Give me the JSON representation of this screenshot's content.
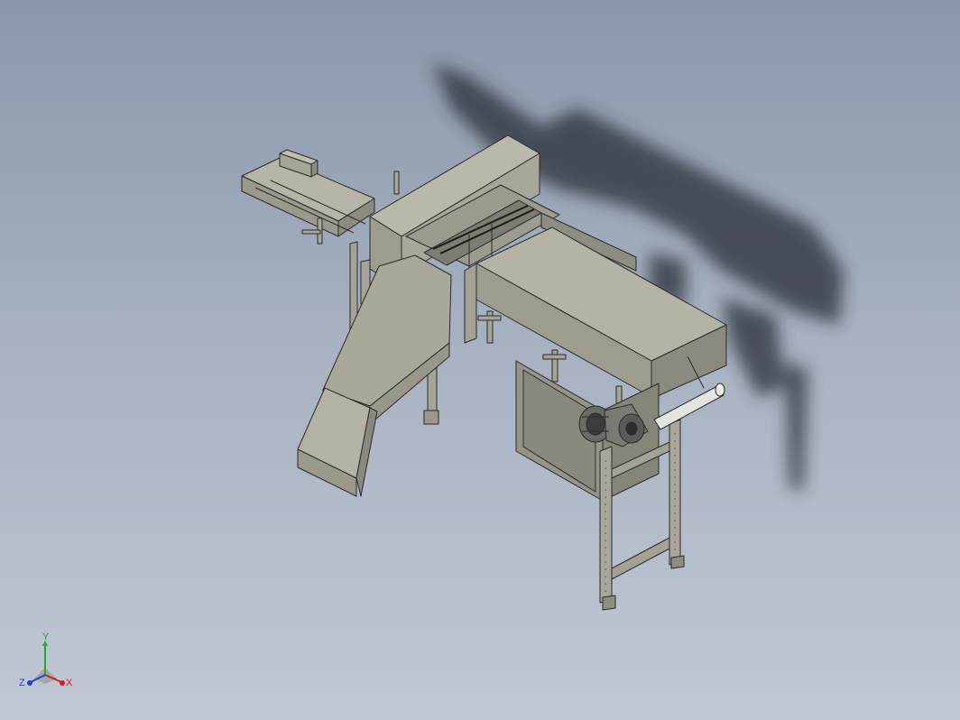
{
  "viewport": {
    "background_top": "#8a97ab",
    "background_bottom": "#c1c8d4",
    "model_color": "#a8a898",
    "edge_color": "#2a2a2a"
  },
  "triad": {
    "y_label": "Y",
    "x_label": "X",
    "z_label": "Z",
    "x_color": "#d42020",
    "y_color": "#20b020",
    "z_color": "#2040d0"
  }
}
